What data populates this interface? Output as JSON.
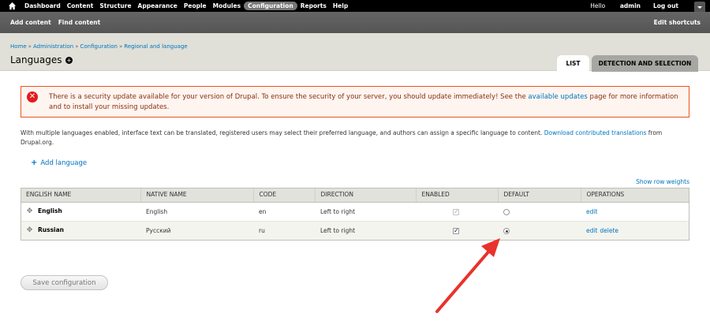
{
  "toolbar": {
    "menu": [
      "Dashboard",
      "Content",
      "Structure",
      "Appearance",
      "People",
      "Modules",
      "Configuration",
      "Reports",
      "Help"
    ],
    "active": "Configuration",
    "hello": "Hello",
    "user": "admin",
    "logout": "Log out"
  },
  "shortcuts": {
    "links": [
      "Add content",
      "Find content"
    ],
    "edit": "Edit shortcuts"
  },
  "breadcrumb": [
    "Home",
    "Administration",
    "Configuration",
    "Regional and language"
  ],
  "page": {
    "title": "Languages",
    "tabs": [
      "LIST",
      "DETECTION AND SELECTION"
    ]
  },
  "message": {
    "before": "There is a security update available for your version of Drupal. To ensure the security of your server, you should update immediately! See the ",
    "link": "available updates",
    "after": " page for more information and to install your missing updates."
  },
  "intro": {
    "before": "With multiple languages enabled, interface text can be translated, registered users may select their preferred language, and authors can assign a specific language to content. ",
    "link": "Download contributed translations",
    "after": " from Drupal.org."
  },
  "add_language": "Add language",
  "show_row_weights": "Show row weights",
  "table": {
    "headers": [
      "ENGLISH NAME",
      "NATIVE NAME",
      "CODE",
      "DIRECTION",
      "ENABLED",
      "DEFAULT",
      "OPERATIONS"
    ],
    "rows": [
      {
        "english": "English",
        "native": "English",
        "code": "en",
        "direction": "Left to right",
        "enabled": true,
        "enabled_disabled": true,
        "default": false,
        "ops": [
          "edit"
        ]
      },
      {
        "english": "Russian",
        "native": "Русский",
        "code": "ru",
        "direction": "Left to right",
        "enabled": true,
        "enabled_disabled": false,
        "default": true,
        "ops": [
          "edit",
          "delete"
        ]
      }
    ]
  },
  "save_label": "Save configuration",
  "colors": {
    "link": "#0074bd",
    "error_border": "#ed541d",
    "error_text": "#8c2e0b",
    "annotation_arrow": "#e8322b"
  }
}
